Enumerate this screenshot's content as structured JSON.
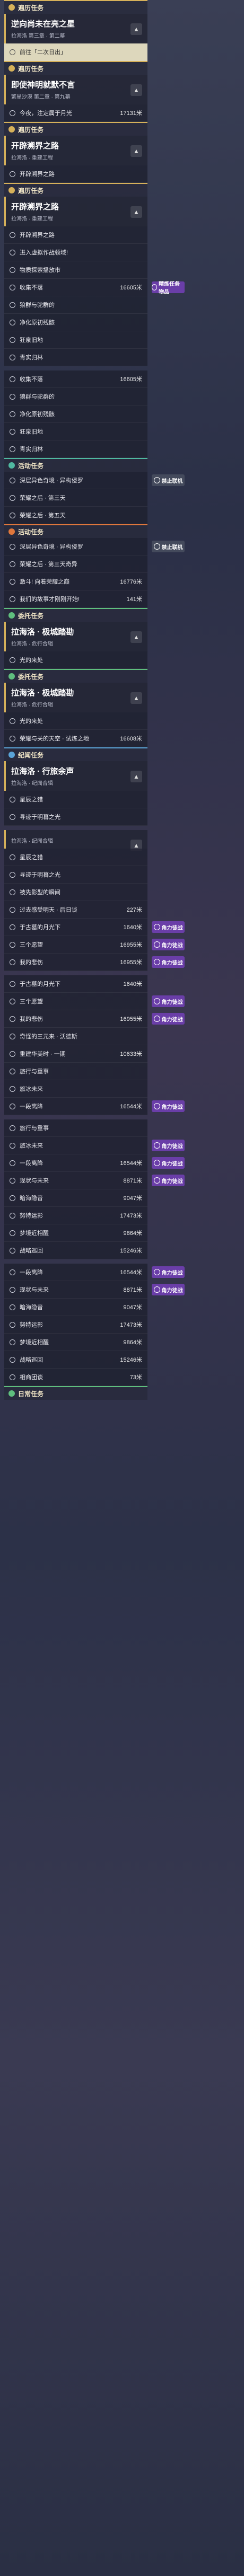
{
  "sections": [
    {
      "type": "header",
      "style": "gold",
      "label": "遍历任务"
    },
    {
      "type": "card",
      "title": "逆向尚未在亮之星",
      "sub": "拉海洛 第三章 · 第二幕"
    },
    {
      "type": "row",
      "label": "前往「二次日出」",
      "dist": "",
      "selected": true
    },
    {
      "type": "header",
      "style": "gold",
      "label": "遍历任务"
    },
    {
      "type": "card",
      "title": "即使神明就默不言",
      "sub": "繁星沙漠 第二章 · 第九幕"
    },
    {
      "type": "row",
      "label": "今夜，注定属于月光",
      "dist": "17131米"
    },
    {
      "type": "header",
      "style": "gold",
      "label": "遍历任务"
    },
    {
      "type": "card",
      "title": "开辟溯界之路",
      "sub": "拉海洛 · 重建工程"
    },
    {
      "type": "row",
      "label": "开辟溯界之路",
      "dist": ""
    },
    {
      "type": "header",
      "style": "gold",
      "label": "遍历任务"
    },
    {
      "type": "card",
      "title": "开辟溯界之路",
      "sub": "拉海洛 · 重建工程"
    },
    {
      "type": "row",
      "label": "开辟溯界之路",
      "dist": ""
    },
    {
      "type": "row",
      "label": "进入虚拟作战领域!",
      "dist": ""
    },
    {
      "type": "row",
      "label": "物质探索播放市",
      "dist": ""
    },
    {
      "type": "row",
      "label": "收集不落",
      "dist": "16605米",
      "badge": "精炼任务物品"
    },
    {
      "type": "row",
      "label": "狼群与驼群的",
      "dist": ""
    },
    {
      "type": "row",
      "label": "净化原初残骸",
      "dist": ""
    },
    {
      "type": "row",
      "label": "狂泉旧地",
      "dist": ""
    },
    {
      "type": "row",
      "label": "青实归林",
      "dist": ""
    },
    {
      "type": "sep"
    },
    {
      "type": "row",
      "label": "收集不落",
      "dist": "16605米"
    },
    {
      "type": "row",
      "label": "狼群与驼群的",
      "dist": ""
    },
    {
      "type": "row",
      "label": "净化原初残骸",
      "dist": ""
    },
    {
      "type": "row",
      "label": "狂泉旧地",
      "dist": ""
    },
    {
      "type": "row",
      "label": "青实归林",
      "dist": ""
    },
    {
      "type": "header",
      "style": "teal",
      "label": "活动任务"
    },
    {
      "type": "row",
      "label": "深层异色奇境 · 异构侵罗",
      "dist": "",
      "badge": "禁止联机",
      "badgeDark": true
    },
    {
      "type": "row",
      "label": "荣耀之后 · 第三天",
      "dist": ""
    },
    {
      "type": "row",
      "label": "荣耀之后 · 第五天",
      "dist": ""
    },
    {
      "type": "header",
      "style": "orange",
      "label": "活动任务"
    },
    {
      "type": "row",
      "label": "深层异色奇境 · 异构侵罗",
      "dist": "",
      "badge": "禁止联机",
      "badgeDark": true
    },
    {
      "type": "row",
      "label": "荣耀之后 · 第三天奇异",
      "dist": ""
    },
    {
      "type": "row",
      "label": "激斗! 向着荣耀之巅",
      "dist": "16776米"
    },
    {
      "type": "row",
      "label": "我们的故事才刚刚开始!",
      "dist": "141米"
    },
    {
      "type": "header",
      "style": "green",
      "label": "委托任务"
    },
    {
      "type": "card",
      "title": "拉海洛 · 极城踏勘",
      "sub": "拉海洛 · 危行合辑"
    },
    {
      "type": "row",
      "label": "光的来处",
      "dist": ""
    },
    {
      "type": "header",
      "style": "green",
      "label": "委托任务"
    },
    {
      "type": "card",
      "title": "拉海洛 · 极城踏勘",
      "sub": "拉海洛 · 危行合辑"
    },
    {
      "type": "row",
      "label": "光的来处",
      "dist": ""
    },
    {
      "type": "row",
      "label": "荣耀与关的天空 · 试炼之地",
      "dist": "16608米"
    },
    {
      "type": "header",
      "style": "blue",
      "label": "纪闻任务"
    },
    {
      "type": "card",
      "title": "拉海洛 · 行旅余声",
      "sub": "拉海洛 · 纪闻合辑"
    },
    {
      "type": "row",
      "label": "星辰之猎",
      "dist": ""
    },
    {
      "type": "row",
      "label": "寻迹于明暮之光",
      "dist": ""
    },
    {
      "type": "sep"
    },
    {
      "type": "card",
      "title": "",
      "sub": "拉海洛 · 纪闻合辑"
    },
    {
      "type": "row",
      "label": "星辰之猎",
      "dist": ""
    },
    {
      "type": "row",
      "label": "寻迹于明暮之光",
      "dist": ""
    },
    {
      "type": "row",
      "label": "被先影型的瞬间",
      "dist": ""
    },
    {
      "type": "row",
      "label": "过去感受明天 · 后日谈",
      "dist": "227米"
    },
    {
      "type": "row",
      "label": "于古墓的月光下",
      "dist": "1640米",
      "badge": "角力徒战"
    },
    {
      "type": "row",
      "label": "三个愿望",
      "dist": "16955米",
      "badge": "角力徒战"
    },
    {
      "type": "row",
      "label": "我的悲伤",
      "dist": "16955米",
      "badge": "角力徒战"
    },
    {
      "type": "sep"
    },
    {
      "type": "row",
      "label": "于古墓的月光下",
      "dist": "1640米"
    },
    {
      "type": "row",
      "label": "三个愿望",
      "dist": "",
      "badge": "角力徒战"
    },
    {
      "type": "row",
      "label": "我的悲伤",
      "dist": "16955米",
      "badge": "角力徒战"
    },
    {
      "type": "row",
      "label": "奇怪的三元来 · 沃德斯",
      "dist": ""
    },
    {
      "type": "row",
      "label": "重建华美时 · 一期",
      "dist": "10633米"
    },
    {
      "type": "row",
      "label": "旅行与重事",
      "dist": ""
    },
    {
      "type": "row",
      "label": "旅冰未来",
      "dist": ""
    },
    {
      "type": "row",
      "label": "一段离降",
      "dist": "16544米",
      "badge": "角力徒战"
    },
    {
      "type": "sep"
    },
    {
      "type": "row",
      "label": "旅行与重事",
      "dist": ""
    },
    {
      "type": "row",
      "label": "旅冰未来",
      "dist": "",
      "badge": "角力徒战"
    },
    {
      "type": "row",
      "label": "一段离降",
      "dist": "16544米",
      "badge": "角力徒战"
    },
    {
      "type": "row",
      "label": "现状与未来",
      "dist": "8871米",
      "badge": "角力徒战"
    },
    {
      "type": "row",
      "label": "暗海隐音",
      "dist": "9047米"
    },
    {
      "type": "row",
      "label": "努特运影",
      "dist": "17473米"
    },
    {
      "type": "row",
      "label": "梦境近相醒",
      "dist": "9864米"
    },
    {
      "type": "row",
      "label": "战略巡回",
      "dist": "15246米"
    },
    {
      "type": "sep"
    },
    {
      "type": "row",
      "label": "一段离降",
      "dist": "16544米",
      "badge": "角力徒战"
    },
    {
      "type": "row",
      "label": "现状与未来",
      "dist": "8871米",
      "badge": "角力徒战"
    },
    {
      "type": "row",
      "label": "暗海隐音",
      "dist": "9047米"
    },
    {
      "type": "row",
      "label": "努特运影",
      "dist": "17473米"
    },
    {
      "type": "row",
      "label": "梦境近相醒",
      "dist": "9864米"
    },
    {
      "type": "row",
      "label": "战略巡回",
      "dist": "15246米"
    },
    {
      "type": "row",
      "label": "相商团谈",
      "dist": "73米"
    },
    {
      "type": "header",
      "style": "green",
      "label": "日常任务"
    }
  ]
}
